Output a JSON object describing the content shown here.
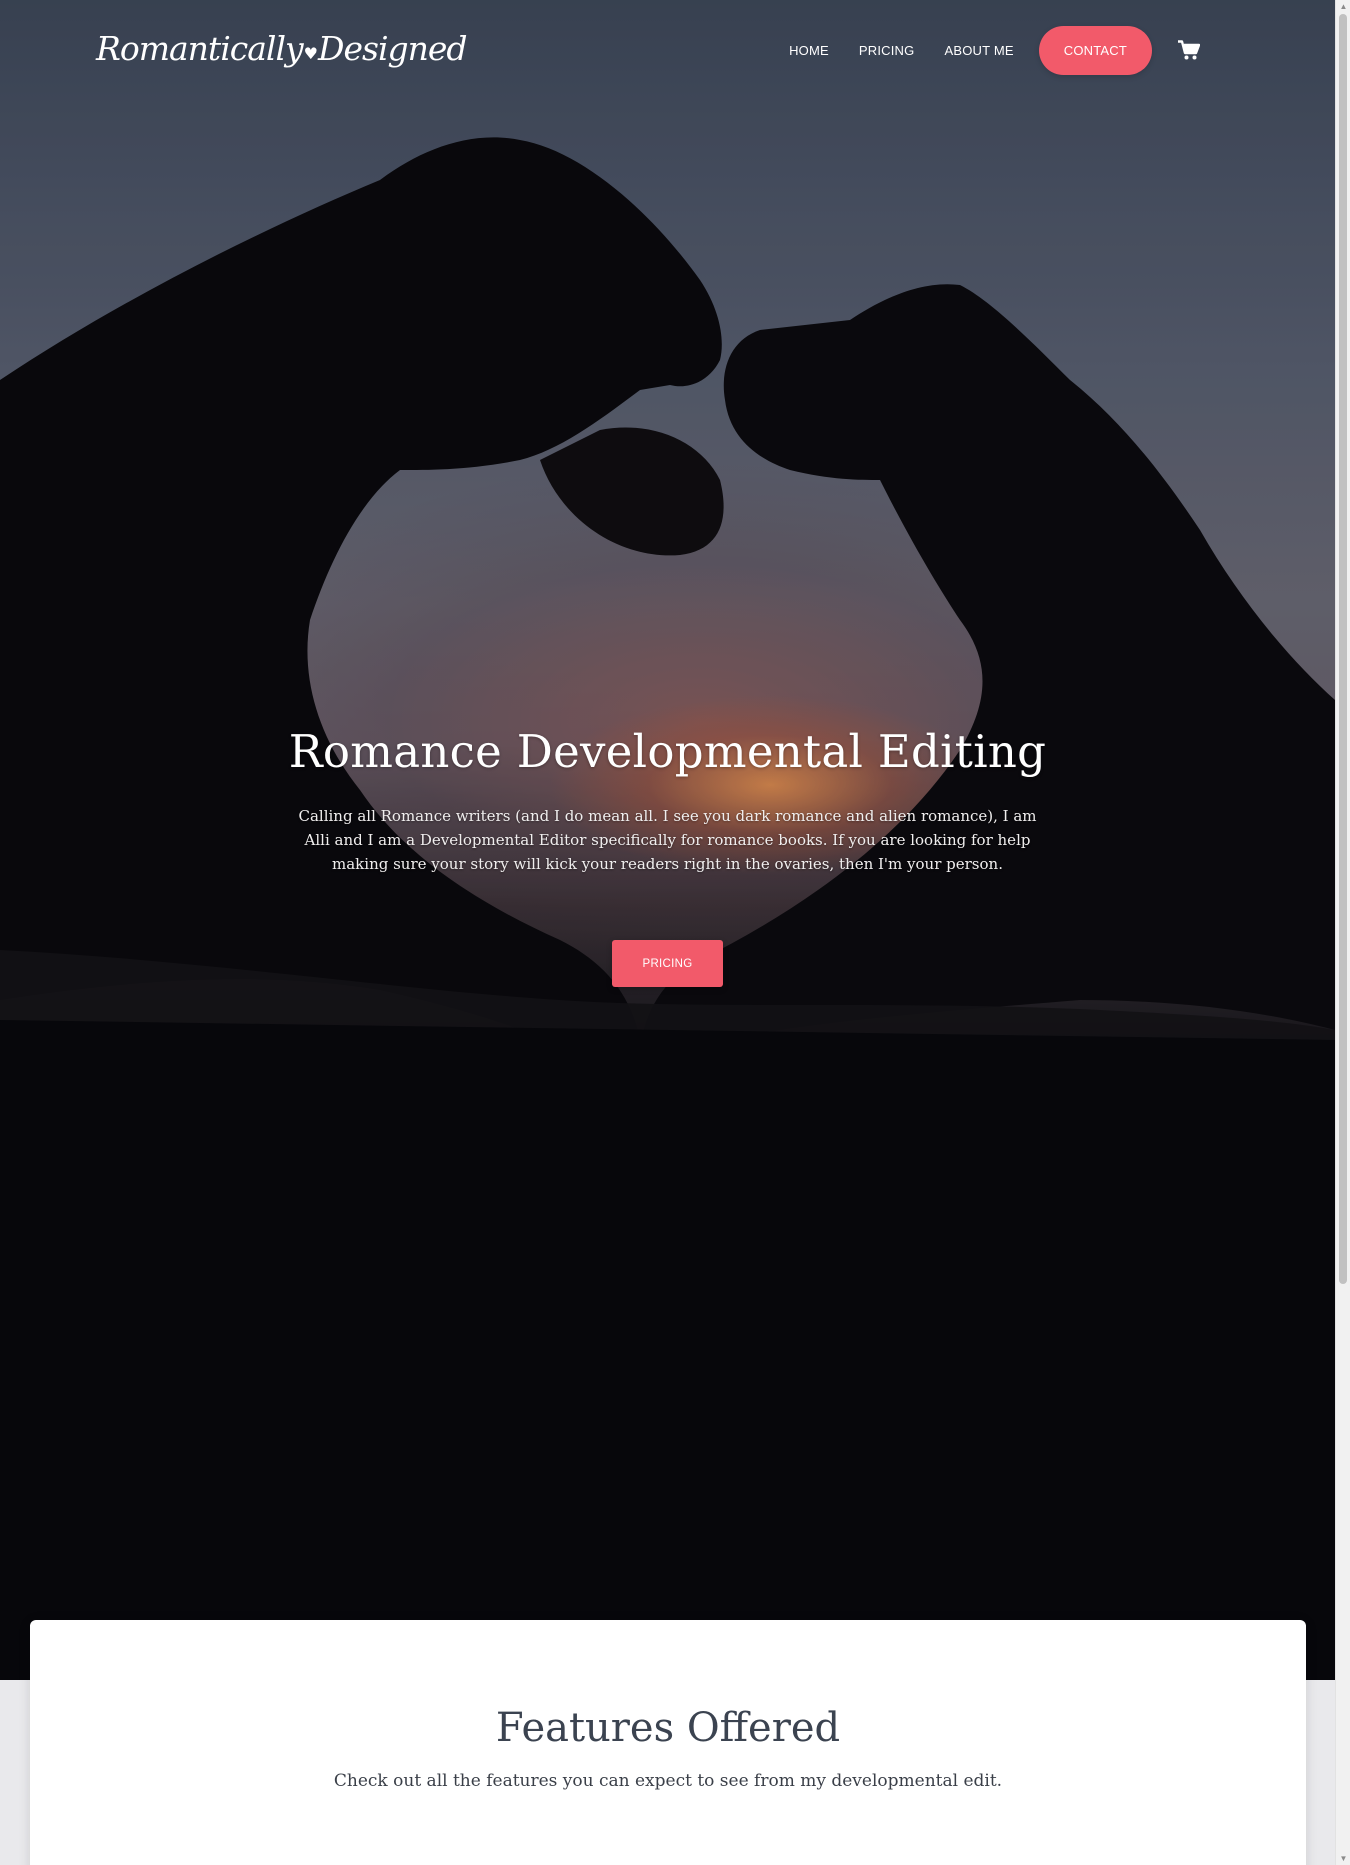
{
  "header": {
    "logo": {
      "part1": "Romantically",
      "heart": "♥",
      "part2": "Designed"
    },
    "nav": [
      {
        "label": "HOME"
      },
      {
        "label": "PRICING"
      },
      {
        "label": "ABOUT ME"
      },
      {
        "label": "CONTACT"
      }
    ],
    "cart_icon": "shopping-cart-icon"
  },
  "hero": {
    "title": "Romance Developmental Editing",
    "text": "Calling all Romance writers (and I do mean all. I see you dark romance and alien romance), I am Alli and I am a Developmental Editor specifically for romance books. If you are looking for help making sure your story will kick your readers right in the ovaries, then I'm your person.",
    "button_label": "PRICING"
  },
  "features": {
    "title": "Features Offered",
    "subtitle": "Check out all the features you can expect to see from my developmental edit."
  },
  "colors": {
    "accent": "#f25a6a",
    "heading": "#3b4350"
  }
}
